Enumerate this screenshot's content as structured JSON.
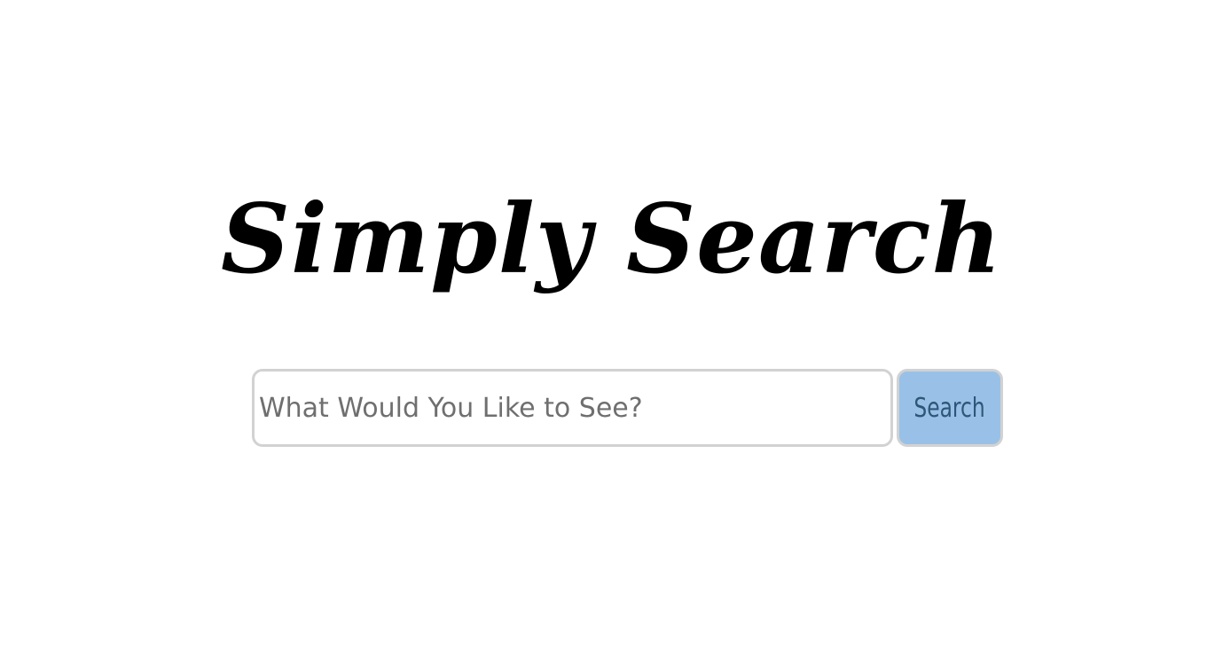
{
  "app": {
    "title": "Simply Search"
  },
  "search": {
    "placeholder": "What Would You Like to See?",
    "value": "",
    "button_label": "Search"
  },
  "colors": {
    "background": "#ffffff",
    "title": "#000000",
    "input_border": "#d2d2d2",
    "placeholder": "#6f6f6f",
    "button_background": "#99c1e8",
    "button_text": "#2f5678"
  }
}
